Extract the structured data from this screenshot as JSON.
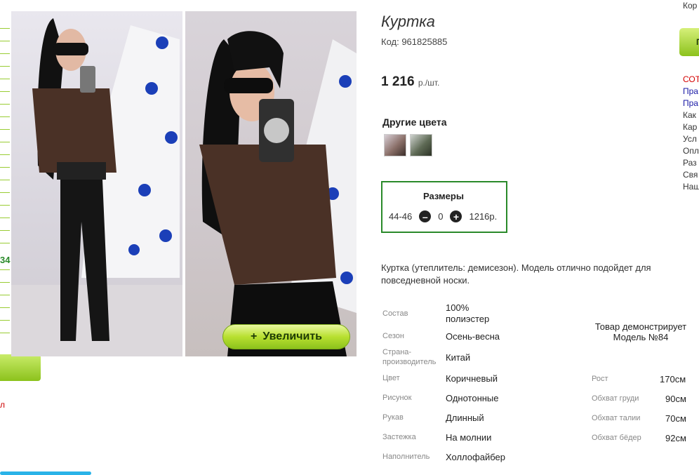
{
  "left_column": {
    "number_fragment": "34",
    "red_fragment": "л"
  },
  "gallery": {
    "zoom_button_label": "Увеличить",
    "zoom_button_icon": "+"
  },
  "product": {
    "title": "Куртка",
    "code": "Код: 961825885",
    "price": "1 216",
    "price_unit": "р./шт.",
    "other_colors_label": "Другие цвета",
    "sizes": {
      "title": "Размеры",
      "size": "44-46",
      "quantity": "0",
      "price": "1216р."
    },
    "description": "Куртка (утеплитель: демисезон). Модель отлично подойдет для повседневной носки.",
    "properties": [
      {
        "label": "Состав",
        "value": "100% полиэстер"
      },
      {
        "label": "Сезон",
        "value": "Осень-весна"
      },
      {
        "label": "Страна-производитель",
        "value": "Китай"
      },
      {
        "label": "Цвет",
        "value": "Коричневый"
      },
      {
        "label": "Рисунок",
        "value": "Однотонные"
      },
      {
        "label": "Рукав",
        "value": "Длинный"
      },
      {
        "label": "Застежка",
        "value": "На молнии"
      },
      {
        "label": "Наполнитель",
        "value": "Холлофайбер"
      }
    ],
    "model": {
      "note": "Товар демонстрирует Модель №84",
      "params": [
        {
          "label": "Рост",
          "value": "170см"
        },
        {
          "label": "Обхват груди",
          "value": "90см"
        },
        {
          "label": "Обхват талии",
          "value": "70см"
        },
        {
          "label": "Обхват бёдер",
          "value": "92см"
        }
      ]
    }
  },
  "right_column": {
    "top_fragment": "Кор",
    "button_fragment": "Пе",
    "links": [
      "СОТ",
      "Пра",
      "Пра",
      "Как",
      "Кар",
      "Усл",
      "Опл",
      "Раз",
      "Свя",
      "Наш"
    ],
    "link_colors": [
      "#d40000",
      "#1a1aa6",
      "#1a1aa6",
      "#333333",
      "#333333",
      "#333333",
      "#333333",
      "#333333",
      "#333333",
      "#333333"
    ]
  }
}
